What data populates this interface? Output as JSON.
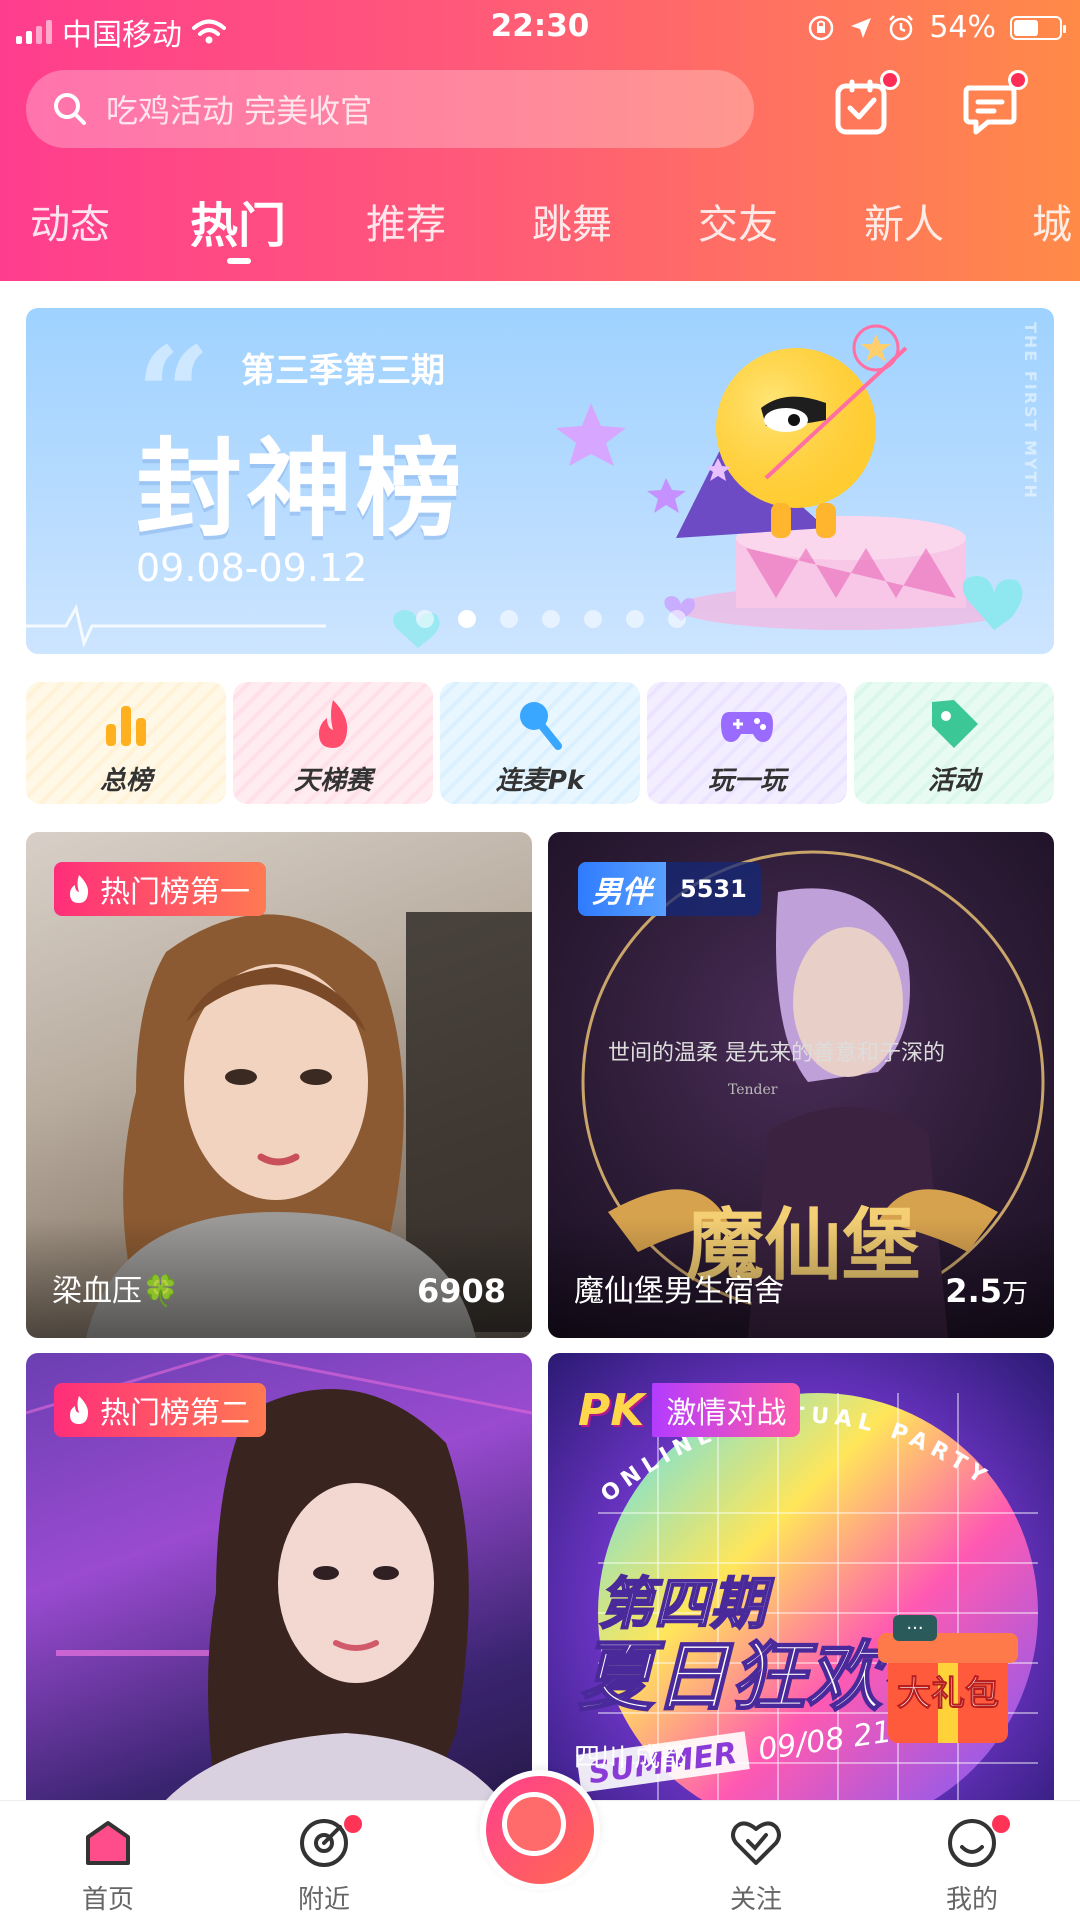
{
  "status": {
    "carrier": "中国移动",
    "time": "22:30",
    "battery": "54%",
    "battery_level": 0.54
  },
  "search": {
    "placeholder": "吃鸡活动 完美收官"
  },
  "tabs": [
    "动态",
    "热门",
    "推荐",
    "跳舞",
    "交友",
    "新人",
    "城"
  ],
  "active_tab": "热门",
  "banner": {
    "subtitle": "第三季第三期",
    "title": "封神榜",
    "date": "09.08-09.12",
    "side_text": "THE FIRST MYTH",
    "slide_count": 7,
    "active_slide": 2
  },
  "categories": [
    {
      "label": "总榜",
      "icon": "bar-chart-icon"
    },
    {
      "label": "天梯赛",
      "icon": "flame-icon"
    },
    {
      "label": "连麦Pk",
      "icon": "microphone-icon"
    },
    {
      "label": "玩一玩",
      "icon": "gamepad-icon"
    },
    {
      "label": "活动",
      "icon": "tag-icon"
    }
  ],
  "cards": [
    {
      "badge": "热门榜第一",
      "name": "梁血压🍀",
      "count": "6908"
    },
    {
      "badge_tag": "男伴",
      "badge_num": "5531",
      "name": "魔仙堡男生宿舍",
      "count": "2.5",
      "count_unit": "万",
      "art_text": "魔仙堡",
      "art_script": "世间的温柔 是先来的善意和于深的",
      "art_script_sub": "Tender"
    },
    {
      "badge": "热门榜第二",
      "name": "",
      "count": ""
    },
    {
      "badge_pk": "PK",
      "badge": "激情对战",
      "location": "四川 成都",
      "art_line1": "第四期",
      "art_line2": "夏日狂欢夜",
      "art_ring": "ONLINE VIRTUAL PARTY",
      "art_summer": "SUMMER",
      "art_date": "09/08 21",
      "gift": "大礼包"
    }
  ],
  "nav": [
    {
      "label": "首页",
      "icon": "home-icon"
    },
    {
      "label": "附近",
      "icon": "radar-icon"
    },
    {
      "label": "",
      "icon": "live-record-icon"
    },
    {
      "label": "关注",
      "icon": "heart-check-icon"
    },
    {
      "label": "我的",
      "icon": "profile-icon"
    }
  ]
}
